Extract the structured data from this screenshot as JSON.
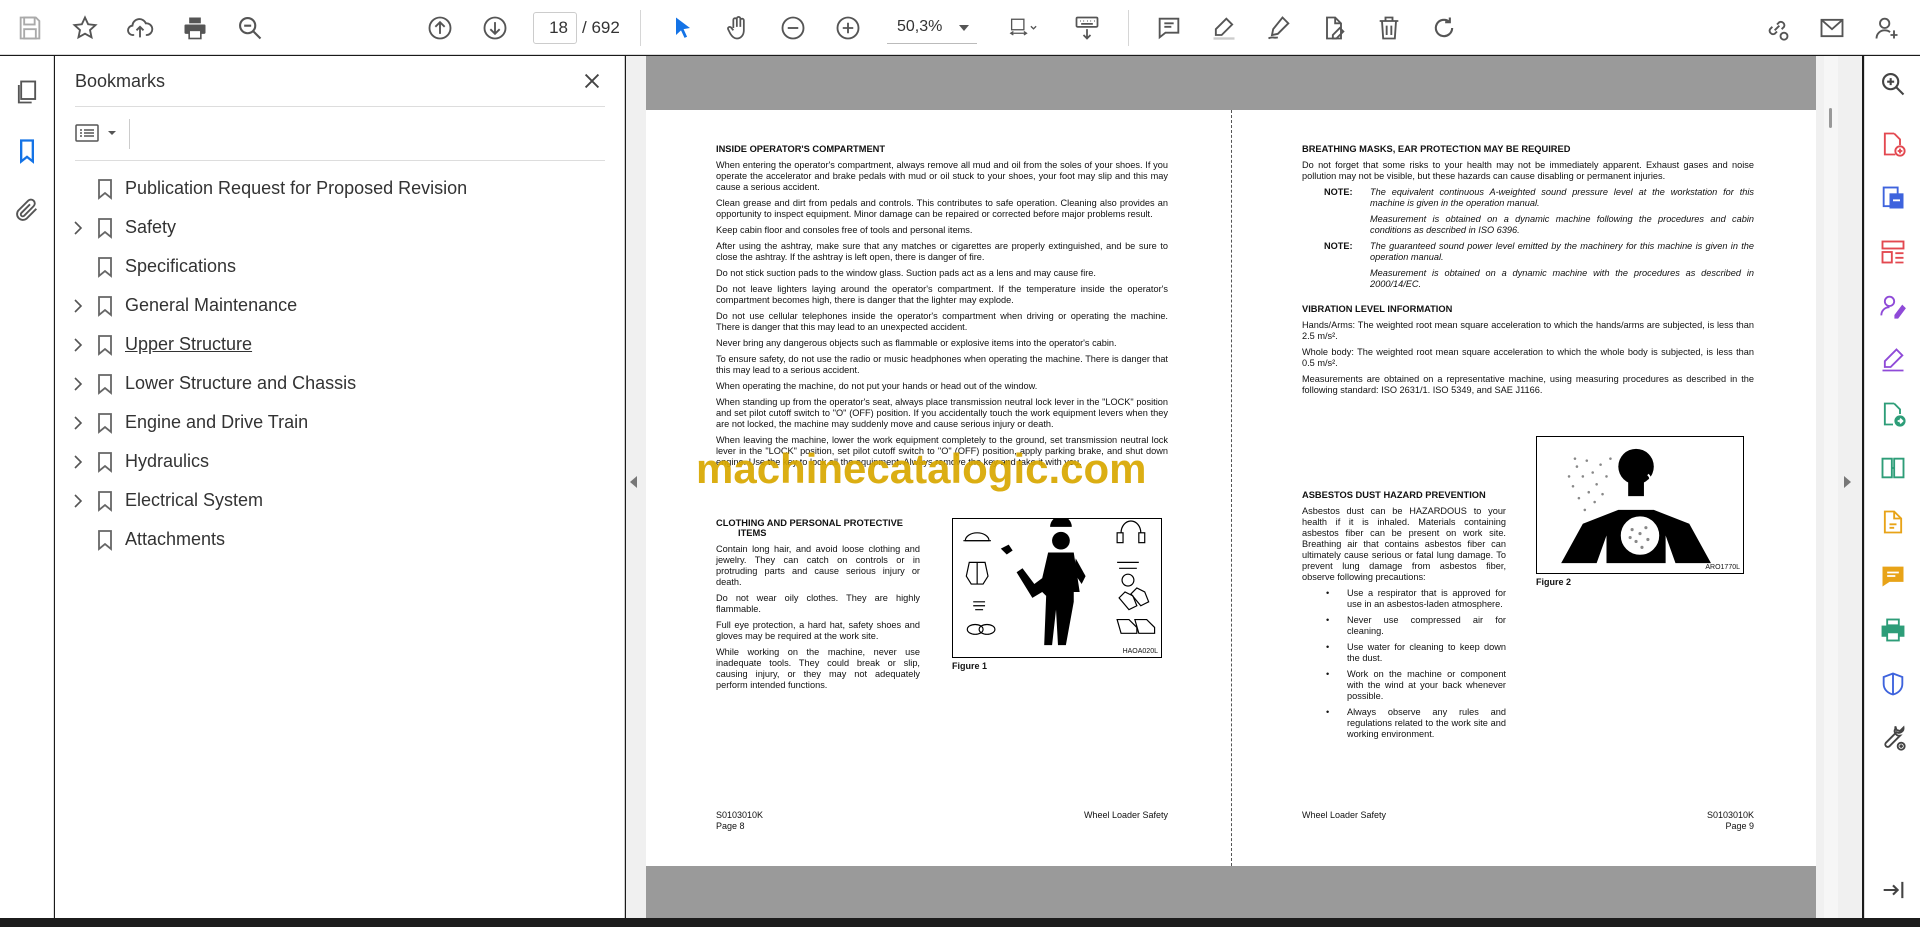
{
  "toolbar": {
    "page_current": "18",
    "page_total": "/ 692",
    "zoom": "50,3%"
  },
  "bookmarks": {
    "title": "Bookmarks",
    "items": [
      {
        "label": "Publication Request for Proposed Revision",
        "expandable": false
      },
      {
        "label": "Safety",
        "expandable": true
      },
      {
        "label": "Specifications",
        "expandable": false
      },
      {
        "label": "General Maintenance",
        "expandable": true
      },
      {
        "label": "Upper Structure",
        "expandable": true,
        "hovered": true
      },
      {
        "label": "Lower Structure and Chassis",
        "expandable": true
      },
      {
        "label": "Engine and Drive Train",
        "expandable": true
      },
      {
        "label": "Hydraulics",
        "expandable": true
      },
      {
        "label": "Electrical System",
        "expandable": true
      },
      {
        "label": "Attachments",
        "expandable": false
      }
    ]
  },
  "doc": {
    "watermark": "machinecatalogic.com",
    "left": {
      "h1": "INSIDE OPERATOR'S COMPARTMENT",
      "paras": [
        "When entering the operator's compartment, always remove all mud and oil from the soles of your shoes. If you operate the accelerator and brake pedals with mud or oil stuck to your shoes, your foot may slip and this may cause a serious accident.",
        "Clean grease and dirt from pedals and controls. This contributes to safe operation. Cleaning also provides an opportunity to inspect equipment. Minor damage can be repaired or corrected before major problems result.",
        "Keep cabin floor and consoles free of tools and personal items.",
        "After using the ashtray, make sure that any matches or cigarettes are properly extinguished, and be sure to close the ashtray. If the ashtray is left open, there is danger of fire.",
        "Do not stick suction pads to the window glass. Suction pads act as a lens and may cause fire.",
        "Do not leave lighters laying around the operator's compartment. If the temperature inside the operator's compartment becomes high, there is danger that the lighter may explode.",
        "Do not use cellular telephones inside the operator's compartment when driving or operating the machine. There is danger that this may lead to an unexpected accident.",
        "Never bring any dangerous objects such as flammable or explosive items into the operator's cabin.",
        "To ensure safety, do not use the radio or music headphones when operating the machine. There is danger that this may lead to a serious accident.",
        "When operating the machine, do not put your hands or head out of the window.",
        "When standing up from the operator's seat, always place transmission neutral lock lever in the \"LOCK\" position and set pilot cutoff switch to \"O\" (OFF) position. If you accidentally touch the work equipment levers when they are not locked, the machine may suddenly move and cause serious injury or death.",
        "When leaving the machine, lower the work equipment completely to the ground, set transmission neutral lock lever in the \"LOCK\" position, set pilot cutoff switch to \"O\" (OFF) position, apply parking brake, and shut down engine. Use the key to lock all the equipment. Always remove the key and take it with you."
      ],
      "h2_line1": "CLOTHING AND PERSONAL PROTECTIVE",
      "h2_line2": "ITEMS",
      "cloth_paras": [
        "Contain long hair, and avoid loose clothing and jewelry. They can catch on controls or in protruding parts and cause serious injury or death.",
        "Do not wear oily clothes. They are highly flammable.",
        "Full eye protection, a hard hat, safety shoes and gloves may be required at the work site.",
        "While working on the machine, never use inadequate tools. They could break or slip, causing injury, or they may not adequately perform intended functions."
      ],
      "fig_code": "HAOA020L",
      "fig_caption": "Figure 1",
      "foot_code": "S0103010K",
      "foot_page": "Page 8",
      "foot_title": "Wheel Loader Safety"
    },
    "right": {
      "h1": "BREATHING MASKS, EAR PROTECTION MAY BE REQUIRED",
      "p1": "Do not forget that some risks to your health may not be immediately apparent. Exhaust gases and noise pollution may not be visible, but these hazards can cause disabling or permanent injuries.",
      "note_label": "NOTE:",
      "note1": "The equivalent continuous A-weighted sound pressure level at the workstation for this machine is given in the operation manual.",
      "note1b": "Measurement is obtained on a dynamic machine following the procedures and cabin conditions as described in ISO 6396.",
      "note2": "The guaranteed sound power level emitted by the machinery for this machine is given in the operation manual.",
      "note2b": "Measurement is obtained on a dynamic machine with the procedures as described in 2000/14/EC.",
      "h2": "VIBRATION LEVEL INFORMATION",
      "vib1": "Hands/Arms: The weighted root mean square acceleration to which the hands/arms are subjected, is less than 2.5 m/s².",
      "vib2": "Whole body: The weighted root mean square acceleration to which the whole body is subjected, is less than 0.5 m/s².",
      "vib3": "Measurements are obtained on a representative machine, using measuring procedures as described in the following standard: ISO 2631/1. ISO 5349, and SAE J1166.",
      "h3": "ASBESTOS DUST HAZARD PREVENTION",
      "asb_p": "Asbestos dust can be HAZARDOUS to your health if it is inhaled. Materials containing asbestos fiber can be present on work site. Breathing air that contains asbestos fiber can ultimately cause serious or fatal lung damage. To prevent lung damage from asbestos fiber, observe following precautions:",
      "bullets": [
        "Use a respirator that is approved for use in an asbestos-laden atmosphere.",
        "Never use compressed air for cleaning.",
        "Use water for cleaning to keep down the dust.",
        "Work on the machine or component with the wind at your back whenever possible.",
        "Always observe any rules and regulations related to the work site and working environment."
      ],
      "fig_code": "ARO1770L",
      "fig_caption": "Figure 2",
      "foot_title": "Wheel Loader Safety",
      "foot_code": "S0103010K",
      "foot_page": "Page 9"
    }
  },
  "colors": {
    "accent_blue": "#1473e6",
    "watermark": "#d9a800",
    "rail_red": "#e34850",
    "rail_purple": "#8f4ad8",
    "rail_green": "#2d9d78",
    "rail_yellow": "#e8a317",
    "rail_blue": "#3e63dd"
  }
}
